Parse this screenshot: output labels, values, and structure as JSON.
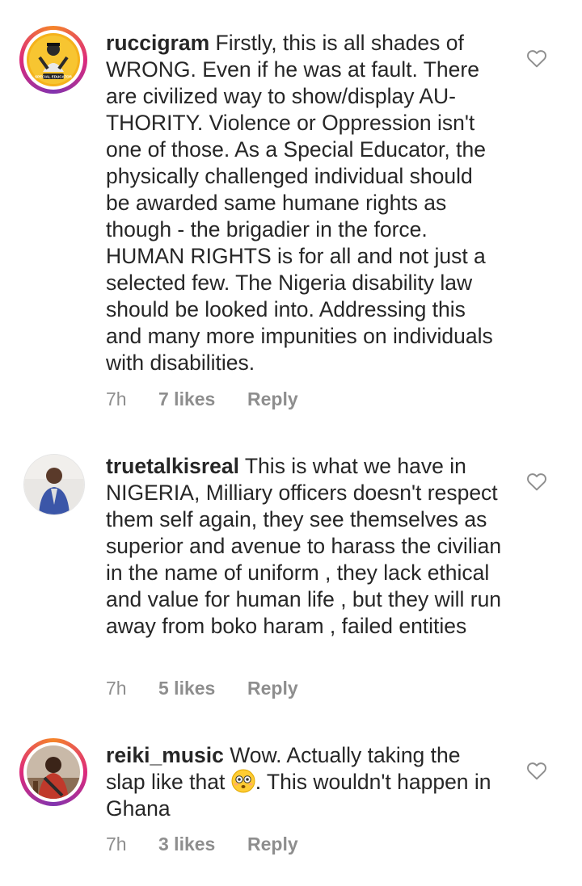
{
  "comments": [
    {
      "username": "ruccigram",
      "text": "Firstly, this is all shades of WRONG. Even if he was at fault. There are civilized way to show/display AU-THORITY. Violence or Oppression isn't one of those. As a Special Educator, the physically challenged individual should be awarded same humane rights as though - the brigadier in the force. HUMAN RIGHTS is for all and not just a selected few. The Nigeria disability law should be looked into. Addressing this and many more impunities on individuals with disabilities.",
      "time": "7h",
      "likes": "7 likes",
      "reply": "Reply",
      "avatar_badge": "SPECIAL EDUCATOR"
    },
    {
      "username": "truetalkisreal",
      "text": "This is what we have in NIGERIA, Milliary officers doesn't respect them self again, they see themselves as superior and avenue to harass the civilian in the name of uniform , they lack ethical and value for human life , but they will run away from boko haram , failed entities",
      "time": "7h",
      "likes": "5 likes",
      "reply": "Reply"
    },
    {
      "username": "reiki_music",
      "text_before": "Wow.  Actually taking the slap like that",
      "text_after": ". This wouldn't happen in Ghana",
      "emoji": "flushed-face-emoji",
      "time": "7h",
      "likes": "3 likes",
      "reply": "Reply"
    }
  ],
  "colors": {
    "text": "#262626",
    "meta": "#8e8e8e",
    "story_ring_start": "#f58529",
    "story_ring_mid": "#dd2a7b",
    "story_ring_end": "#8134af"
  },
  "icons": {
    "like": "heart-outline-icon"
  }
}
